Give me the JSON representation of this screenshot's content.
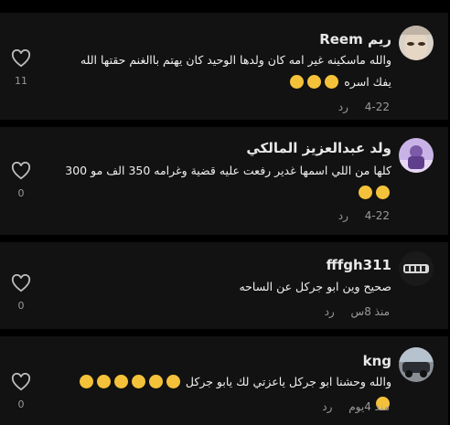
{
  "comments": [
    {
      "username": "ريم Reem",
      "text": "والله ماسكينه غير امه كان ولدها الوحيد كان يهتم باالغنم حقتها الله يفك اسره",
      "emojis": [
        "sad",
        "sad",
        "sad"
      ],
      "date": "4-22",
      "reply": "رد",
      "likes": "11"
    },
    {
      "username": "ولد عبدالعزيز المالكي",
      "text": "كلها من اللي اسمها غدير رفعت عليه قضية وغرامه 350 الف مو 300",
      "emojis": [
        "laugh",
        "laugh"
      ],
      "date": "4-22",
      "reply": "رد",
      "likes": "0"
    },
    {
      "username": "fffgh311",
      "text": "صحيح وين ابو جركل عن الساحه",
      "emojis": [],
      "date": "منذ 8س",
      "reply": "رد",
      "likes": "0"
    },
    {
      "username": "kng",
      "text": "والله وحشنا ابو جركل ياعزتي لك يابو جركل",
      "emojis": [
        "pensive",
        "pensive",
        "pensive",
        "pensive",
        "pensive",
        "pensive",
        "pensive"
      ],
      "date": "منذ 4يوم",
      "reply": "رد",
      "likes": "0"
    }
  ],
  "colors": {
    "card_background": "#121212",
    "separator": "#000000",
    "emoji": "#f4c23a",
    "meta_text": "#9a9a9a"
  },
  "icons": {
    "like": "heart-outline-icon"
  }
}
